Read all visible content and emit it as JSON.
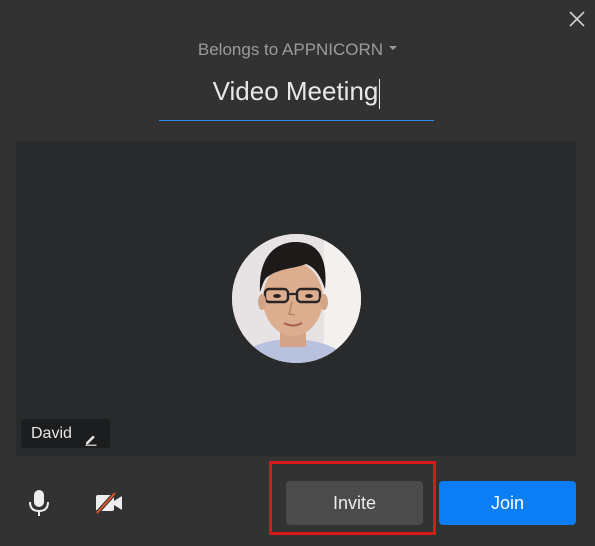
{
  "header": {
    "owner_label": "Belongs to APPNICORN",
    "meeting_title": "Video Meeting"
  },
  "preview": {
    "participant_name": "David"
  },
  "toolbar": {
    "mic_icon": "microphone-icon",
    "camera_icon": "camera-off-icon",
    "invite_label": "Invite",
    "join_label": "Join"
  },
  "colors": {
    "background": "#323232",
    "preview_bg": "#282a2b",
    "accent_blue": "#0b7df5",
    "underline_blue": "#2e8cf0",
    "highlight_red": "#d7191c",
    "camera_slash": "#e0542b"
  }
}
